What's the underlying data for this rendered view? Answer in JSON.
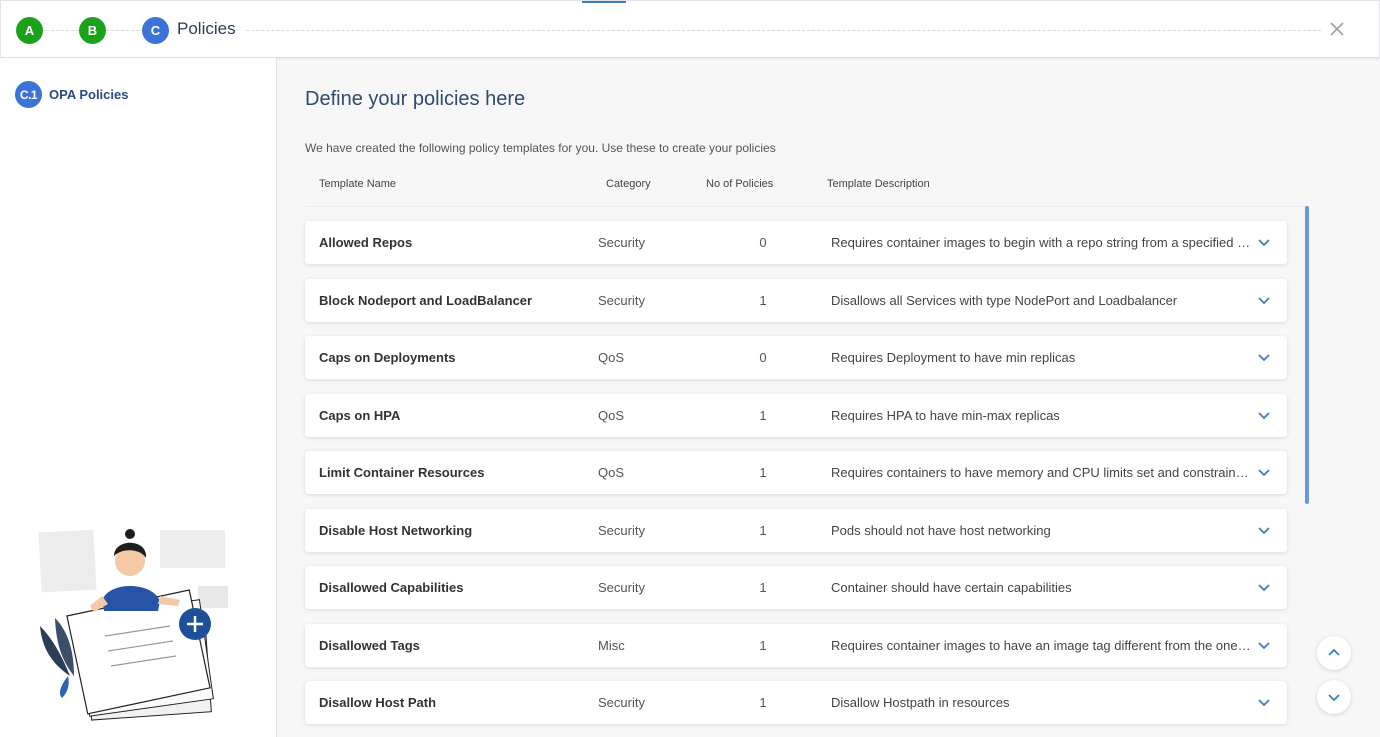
{
  "wizard": {
    "steps": [
      {
        "label": "A",
        "state": "done"
      },
      {
        "label": "B",
        "state": "done"
      },
      {
        "label": "C",
        "state": "active"
      }
    ],
    "current_title": "Policies",
    "close_icon": "close-icon"
  },
  "sidebar": {
    "items": [
      {
        "badge": "C.1",
        "label": "OPA Policies"
      }
    ]
  },
  "main": {
    "title": "Define your policies here",
    "subtitle": "We have created the following policy templates for you. Use these to create your policies",
    "columns": [
      "Template Name",
      "Category",
      "No of Policies",
      "Template Description"
    ],
    "rows": [
      {
        "name": "Allowed Repos",
        "category": "Security",
        "count": "0",
        "description": "Requires container images to begin with a repo string from a specified list"
      },
      {
        "name": "Block Nodeport and LoadBalancer",
        "category": "Security",
        "count": "1",
        "description": "Disallows all Services with type NodePort and Loadbalancer"
      },
      {
        "name": "Caps on Deployments",
        "category": "QoS",
        "count": "0",
        "description": "Requires Deployment to have min replicas"
      },
      {
        "name": "Caps on HPA",
        "category": "QoS",
        "count": "1",
        "description": "Requires HPA to have min-max replicas"
      },
      {
        "name": "Limit Container Resources",
        "category": "QoS",
        "count": "1",
        "description": "Requires containers to have memory and CPU limits set and constrains limits"
      },
      {
        "name": "Disable Host Networking",
        "category": "Security",
        "count": "1",
        "description": "Pods should not have host networking"
      },
      {
        "name": "Disallowed Capabilities",
        "category": "Security",
        "count": "1",
        "description": "Container should have certain capabilities"
      },
      {
        "name": "Disallowed Tags",
        "category": "Misc",
        "count": "1",
        "description": "Requires container images to have an image tag different from the ones in the list"
      },
      {
        "name": "Disallow Host Path",
        "category": "Security",
        "count": "1",
        "description": "Disallow Hostpath in resources"
      }
    ]
  },
  "colors": {
    "done": "#1aa31a",
    "active": "#3b73d8",
    "accent": "#3f7bbf",
    "title": "#2f4a73"
  }
}
